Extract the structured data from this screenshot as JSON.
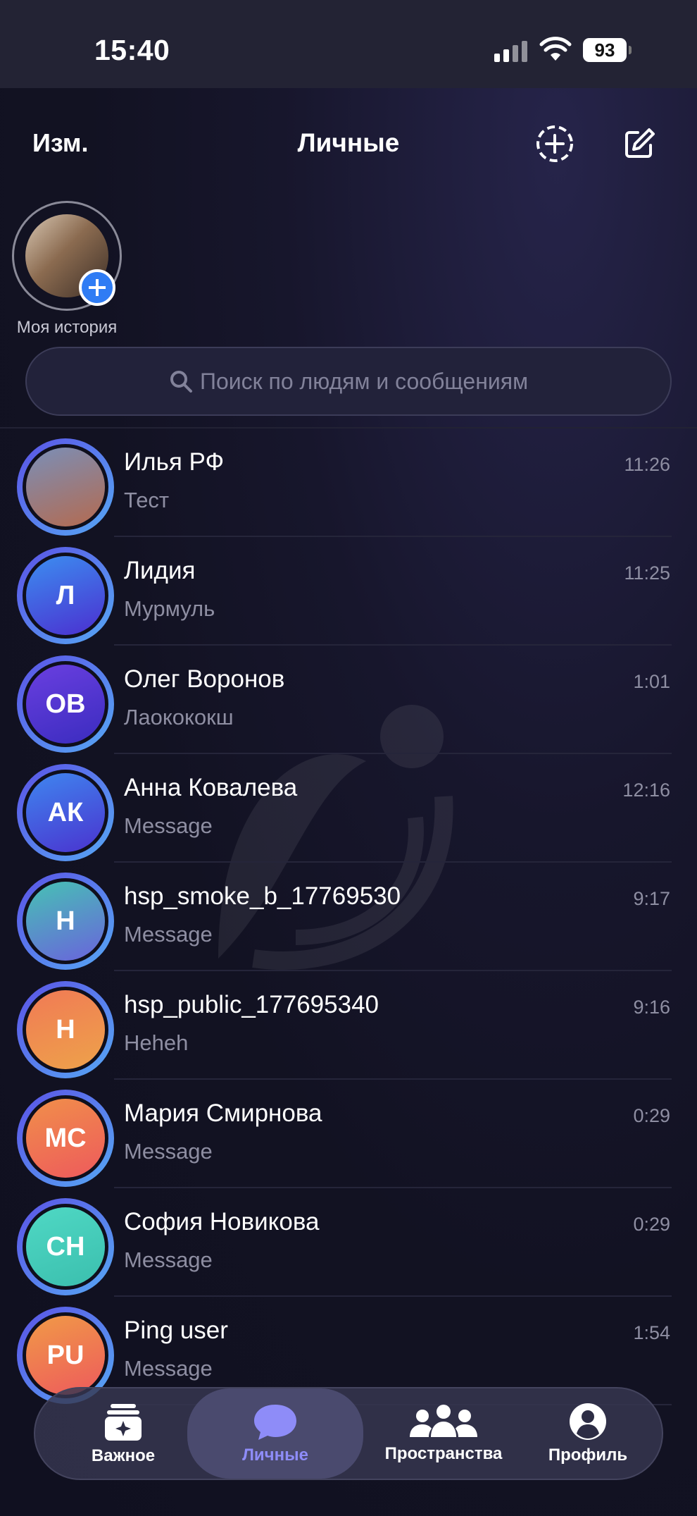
{
  "status_bar": {
    "time": "15:40",
    "battery": "93"
  },
  "header": {
    "edit": "Изм.",
    "title": "Личные"
  },
  "story": {
    "label": "Моя история"
  },
  "search": {
    "placeholder": "Поиск по людям и сообщениям"
  },
  "chats": [
    {
      "name": "Илья РФ",
      "preview": "Тест",
      "time": "11:26",
      "initials": "",
      "photo": true,
      "colors": [
        "#7a8fb8",
        "#b46a4f"
      ]
    },
    {
      "name": "Лидия",
      "preview": "Мурмуль",
      "time": "11:25",
      "initials": "Л",
      "colors": [
        "#3c8ef0",
        "#4b2fd0"
      ]
    },
    {
      "name": "Олег Воронов",
      "preview": "Лаокококш",
      "time": "1:01",
      "initials": "ОВ",
      "colors": [
        "#6a3fe0",
        "#3b2cbf"
      ]
    },
    {
      "name": "Анна Ковалева",
      "preview": "Message",
      "time": "12:16",
      "initials": "АК",
      "colors": [
        "#3f86ef",
        "#4a33cf"
      ]
    },
    {
      "name": "hsp_smoke_b_17769530",
      "preview": "Message",
      "time": "9:17",
      "initials": "H",
      "colors": [
        "#46c2b4",
        "#6a63dc"
      ]
    },
    {
      "name": "hsp_public_177695340",
      "preview": "Heheh",
      "time": "9:16",
      "initials": "H",
      "colors": [
        "#f07a55",
        "#eea24a"
      ]
    },
    {
      "name": "Мария Смирнова",
      "preview": "Message",
      "time": "0:29",
      "initials": "МС",
      "colors": [
        "#f08f4a",
        "#ee5a5c"
      ]
    },
    {
      "name": "София Новикова",
      "preview": "Message",
      "time": "0:29",
      "initials": "СН",
      "colors": [
        "#4fd8c4",
        "#3bbfae"
      ]
    },
    {
      "name": "Ping user",
      "preview": "Message",
      "time": "1:54",
      "initials": "PU",
      "colors": [
        "#f09a47",
        "#ee5a5c"
      ]
    }
  ],
  "tabs": [
    {
      "label": "Важное",
      "icon": "sparkle-cards-icon"
    },
    {
      "label": "Личные",
      "icon": "chat-bubble-icon"
    },
    {
      "label": "Пространства",
      "icon": "people-icon"
    },
    {
      "label": "Профиль",
      "icon": "profile-icon"
    }
  ]
}
